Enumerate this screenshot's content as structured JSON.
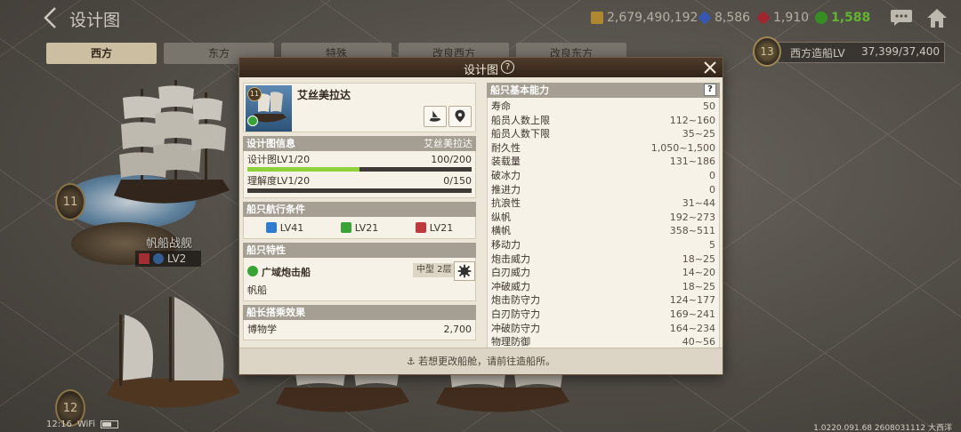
{
  "header": {
    "title": "设计图",
    "resources": {
      "gold": "2,679,490,192",
      "blue_gem": "8,586",
      "red_gem": "1,910",
      "green": "1,588"
    }
  },
  "tabs": [
    "西方",
    "东方",
    "特殊",
    "改良西方",
    "改良东方"
  ],
  "shipyard": {
    "label": "西方造船LV",
    "value": "37,399/37,400",
    "level": "13"
  },
  "ship_card": {
    "level": "11",
    "name": "帆船战舰",
    "lv": "LV2"
  },
  "bottom_level": "12",
  "status": {
    "time": "12:16",
    "net": "WiFi"
  },
  "build": "1.0220.091.68 2608031112 大西洋",
  "dialog": {
    "title": "设计图",
    "help": "?",
    "ship": {
      "level": "11",
      "name": "艾丝美拉达"
    },
    "design_info": {
      "header": "设计图信息",
      "name": "艾丝美拉达",
      "design_label": "设计图LV1/20",
      "design_value": "100/200",
      "design_progress": 0.5,
      "understanding_label": "理解度LV1/20",
      "understanding_value": "0/150",
      "understanding_progress": 0
    },
    "conditions": {
      "header": "船只航行条件",
      "items": [
        {
          "label": "LV41",
          "color": "#2e7bd1"
        },
        {
          "label": "LV21",
          "color": "#3aa335"
        },
        {
          "label": "LV21",
          "color": "#c0383e"
        }
      ]
    },
    "traits": {
      "header": "船只特性",
      "name": "广域炮击船",
      "tag": "中型 2层",
      "type": "帆船"
    },
    "captain": {
      "header": "船长搭乘效果",
      "skill": "博物学",
      "value": "2,700"
    },
    "abilities": {
      "header": "船只基本能力",
      "help": "?",
      "stats": [
        {
          "label": "寿命",
          "value": "50"
        },
        {
          "label": "船员人数上限",
          "value": "112~160"
        },
        {
          "label": "船员人数下限",
          "value": "35~25"
        },
        {
          "label": "耐久性",
          "value": "1,050~1,500"
        },
        {
          "label": "装载量",
          "value": "131~186"
        },
        {
          "label": "破冰力",
          "value": "0"
        },
        {
          "label": "推进力",
          "value": "0"
        },
        {
          "label": "抗浪性",
          "value": "31~44"
        },
        {
          "label": "纵帆",
          "value": "192~273"
        },
        {
          "label": "横帆",
          "value": "358~511"
        },
        {
          "label": "移动力",
          "value": "5"
        },
        {
          "label": "炮击威力",
          "value": "18~25"
        },
        {
          "label": "白刃威力",
          "value": "14~20"
        },
        {
          "label": "冲破威力",
          "value": "18~25"
        },
        {
          "label": "炮击防守力",
          "value": "124~177"
        },
        {
          "label": "白刃防守力",
          "value": "169~241"
        },
        {
          "label": "冲破防守力",
          "value": "164~234"
        },
        {
          "label": "物理防御",
          "value": "40~56"
        }
      ]
    },
    "footer": "若想更改船舱，请前往造船所。"
  }
}
